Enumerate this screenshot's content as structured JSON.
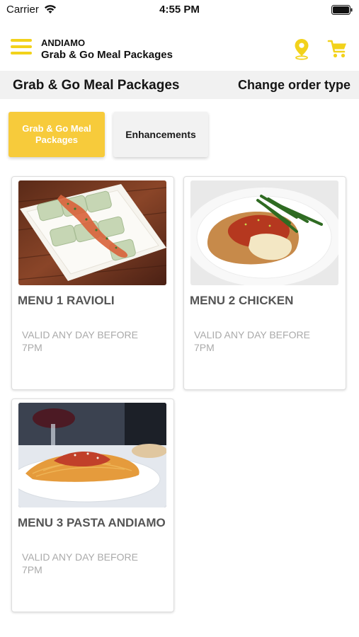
{
  "status_bar": {
    "carrier": "Carrier",
    "time": "4:55 PM",
    "icons": [
      "wifi-icon",
      "battery-icon"
    ]
  },
  "header": {
    "brand": "ANDIAMO",
    "subtitle": "Grab & Go Meal Packages",
    "icons": [
      "hamburger-menu-icon",
      "location-pin-icon",
      "cart-icon"
    ],
    "accent_color": "#f2d21b"
  },
  "section": {
    "title": "Grab & Go Meal Packages",
    "change_order_label": "Change order type",
    "background_color": "#f1f1f1"
  },
  "tabs": [
    {
      "label": "Grab & Go Meal Packages",
      "active": true,
      "color": "#f7cb3b"
    },
    {
      "label": "Enhancements",
      "active": false,
      "color": "#f2f2f2"
    }
  ],
  "menu_items": [
    {
      "title": "MENU 1 RAVIOLI",
      "description": "VALID ANY DAY BEFORE 7PM",
      "image": "ravioli-photo"
    },
    {
      "title": "MENU 2 CHICKEN",
      "description": "VALID ANY DAY BEFORE 7PM",
      "image": "chicken-parmesan-photo"
    },
    {
      "title": "MENU 3 PASTA ANDIAMO",
      "description": "VALID ANY DAY BEFORE 7PM",
      "image": "pasta-photo"
    }
  ]
}
